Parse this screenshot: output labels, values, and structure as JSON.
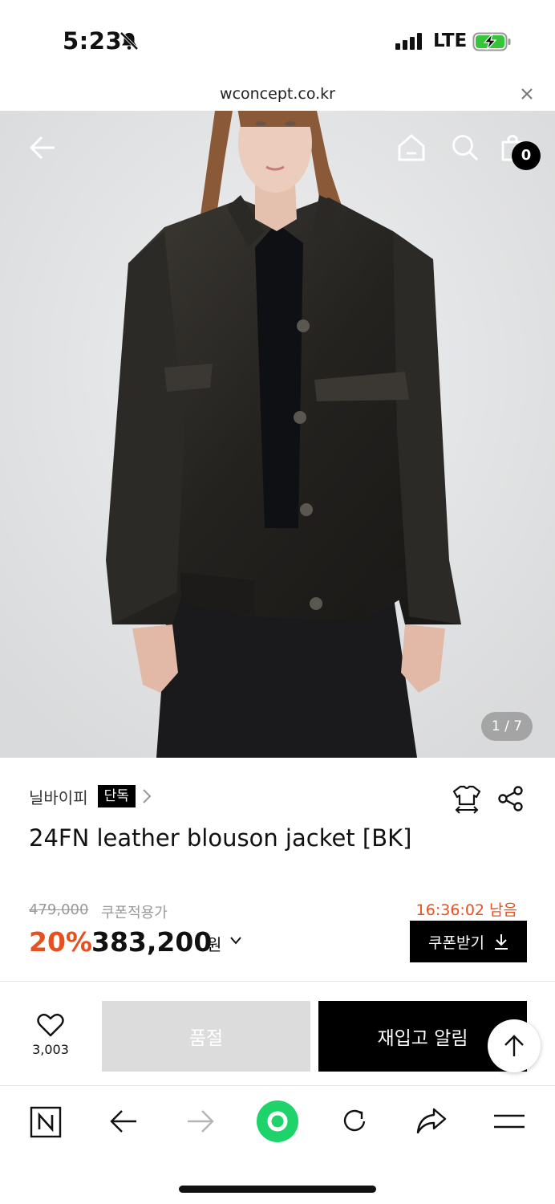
{
  "status_bar": {
    "time": "5:23",
    "network": "LTE"
  },
  "browser_url": {
    "domain": "wconcept.co.kr"
  },
  "header": {
    "cart_count": "0"
  },
  "gallery": {
    "counter": "1 / 7"
  },
  "product": {
    "brand": "닐바이피",
    "exclusive_badge": "단독",
    "title": "24FN leather blouson jacket [BK]"
  },
  "pricing": {
    "original_price": "479,000",
    "coupon_price_label": "쿠폰적용가",
    "timer": "16:36:02 남음",
    "discount": "20%",
    "sale_price": "383,200",
    "currency": "원",
    "coupon_button": "쿠폰받기"
  },
  "actions": {
    "like_count": "3,003",
    "soldout_button": "품절",
    "restock_button": "재입고 알림"
  },
  "colors": {
    "accent": "#e8501f",
    "browser_green": "#1fd36b"
  }
}
